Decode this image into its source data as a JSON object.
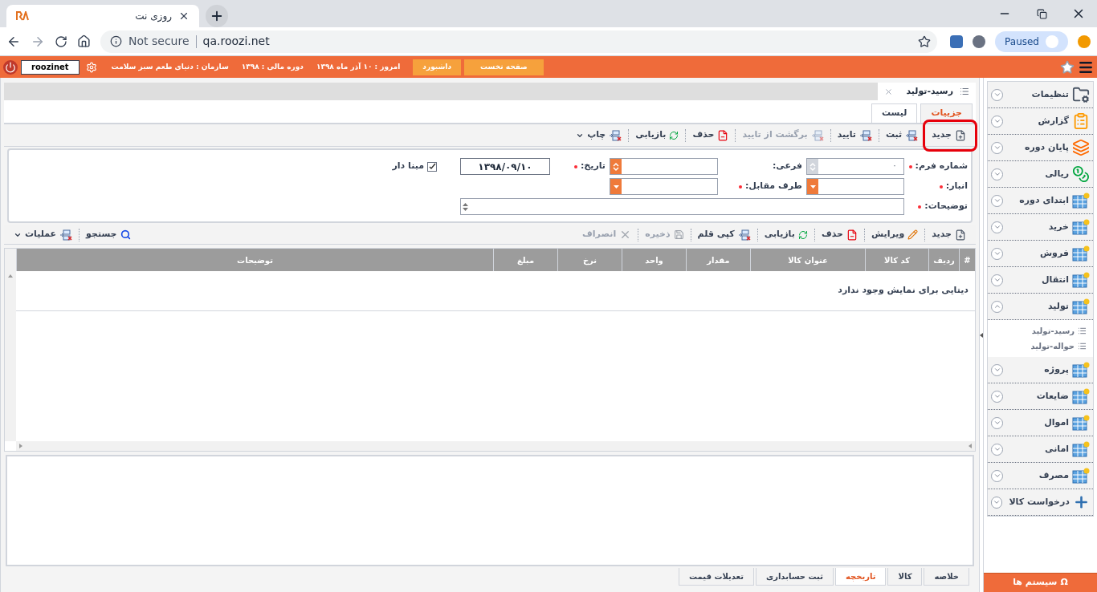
{
  "browser": {
    "tab_title": "روزی نت",
    "security": "Not secure",
    "url": "qa.roozi.net",
    "profile": "Paused"
  },
  "header": {
    "user": "roozinet",
    "buttons": [
      "صفحه نخست",
      "داشبورد"
    ],
    "info": [
      "امروز : ۱۰ آذر ماه ۱۳۹۸",
      "دوره مالی : ۱۳۹۸",
      "سازمان : دنیای طعم سبز سلامت"
    ]
  },
  "document_tab": {
    "title": "رسید-تولید"
  },
  "view_tabs": [
    {
      "label": "جزییات",
      "selected": true
    },
    {
      "label": "لیست",
      "selected": false
    }
  ],
  "toolbar": [
    {
      "kind": "new",
      "label": "جدید",
      "disabled": false,
      "menu": false
    },
    {
      "kind": "network",
      "label": "ثبت",
      "disabled": false,
      "menu": false
    },
    {
      "kind": "network",
      "label": "تایید",
      "disabled": false,
      "menu": false
    },
    {
      "kind": "network",
      "label": "برگشت از تایید",
      "disabled": true,
      "menu": false
    },
    {
      "kind": "delete",
      "label": "حذف",
      "disabled": false,
      "menu": false
    },
    {
      "kind": "refresh",
      "label": "بازیابی",
      "disabled": false,
      "menu": false
    },
    {
      "kind": "network",
      "label": "چاپ",
      "disabled": false,
      "menu": true
    }
  ],
  "form": {
    "rows": [
      [
        {
          "kind": "spinner",
          "label": "شماره فرم:",
          "required": true,
          "value": "۰",
          "disabled": true
        },
        {
          "kind": "spinner",
          "label": "فرعی:",
          "required": false,
          "disabled": false
        },
        {
          "kind": "text",
          "label": "تاریخ:",
          "required": true,
          "value": "۱۳۹۸/۰۹/۱۰"
        },
        {
          "kind": "checkbox",
          "label": "مبنا دار",
          "checked": true
        }
      ],
      [
        {
          "kind": "dropdown",
          "label": "انبار:",
          "required": true,
          "disabled": false
        },
        {
          "kind": "dropdown",
          "label": "طرف مقابل:",
          "required": true,
          "disabled": false
        }
      ],
      [
        {
          "kind": "memo",
          "label": "توضیحات:",
          "required": true
        }
      ]
    ]
  },
  "items_toolbar": [
    {
      "kind": "new",
      "label": "جدید",
      "disabled": false,
      "menu": false
    },
    {
      "kind": "edit",
      "label": "ویرایش",
      "disabled": false,
      "menu": false
    },
    {
      "kind": "delete",
      "label": "حذف",
      "disabled": false,
      "menu": false
    },
    {
      "kind": "refresh",
      "label": "بازیابی",
      "disabled": false,
      "menu": false
    },
    {
      "kind": "network",
      "label": "کپی قلم",
      "disabled": false,
      "menu": false
    },
    {
      "kind": "floppy",
      "label": "ذخیره",
      "disabled": true,
      "menu": false
    },
    {
      "kind": "cross",
      "label": "انصراف",
      "disabled": true,
      "menu": false
    }
  ],
  "items_toolbar_left": [
    {
      "kind": "search",
      "label": "جستجو",
      "disabled": false,
      "menu": false
    },
    {
      "kind": "network",
      "label": "عملیات",
      "disabled": false,
      "menu": true
    }
  ],
  "table": {
    "columns": [
      "#",
      "ردیف",
      "کد کالا",
      "عنوان کالا",
      "مقدار",
      "واحد",
      "نرخ",
      "مبلغ",
      "توضیحات"
    ],
    "empty_message": "دیتایی برای نمایش وجود ندارد"
  },
  "bottom_tabs": [
    {
      "label": "خلاصه",
      "selected": false
    },
    {
      "label": "کالا",
      "selected": false
    },
    {
      "label": "تاریخچه",
      "selected": true
    },
    {
      "label": "ثبت حسابداری",
      "selected": false
    },
    {
      "label": "تعدیلات قیمت",
      "selected": false
    }
  ],
  "sidebar": {
    "items": [
      {
        "kind": "folder",
        "label": "تنظیمات",
        "expanded": false
      },
      {
        "kind": "clipboard",
        "label": "گزارش",
        "expanded": false
      },
      {
        "kind": "stack",
        "label": "پایان دوره",
        "expanded": false
      },
      {
        "kind": "coins",
        "label": "ریالی",
        "expanded": false
      },
      {
        "kind": "table",
        "label": "ابتدای دوره",
        "expanded": false
      },
      {
        "kind": "table",
        "label": "خرید",
        "expanded": false
      },
      {
        "kind": "table",
        "label": "فروش",
        "expanded": false
      },
      {
        "kind": "table",
        "label": "انتقال",
        "expanded": false
      },
      {
        "kind": "table",
        "label": "تولید",
        "expanded": true,
        "children": [
          {
            "label": "رسید-تولید"
          },
          {
            "label": "حواله-تولید"
          }
        ]
      },
      {
        "kind": "table",
        "label": "پروژه",
        "expanded": false
      },
      {
        "kind": "table",
        "label": "ضایعات",
        "expanded": false
      },
      {
        "kind": "table",
        "label": "اموال",
        "expanded": false
      },
      {
        "kind": "table",
        "label": "امانی",
        "expanded": false
      },
      {
        "kind": "table",
        "label": "مصرف",
        "expanded": false
      },
      {
        "kind": "plus",
        "label": "درخواست کالا",
        "expanded": false
      }
    ],
    "systems_button": {
      "icon": "Ω",
      "label": "سیستم ها"
    }
  }
}
